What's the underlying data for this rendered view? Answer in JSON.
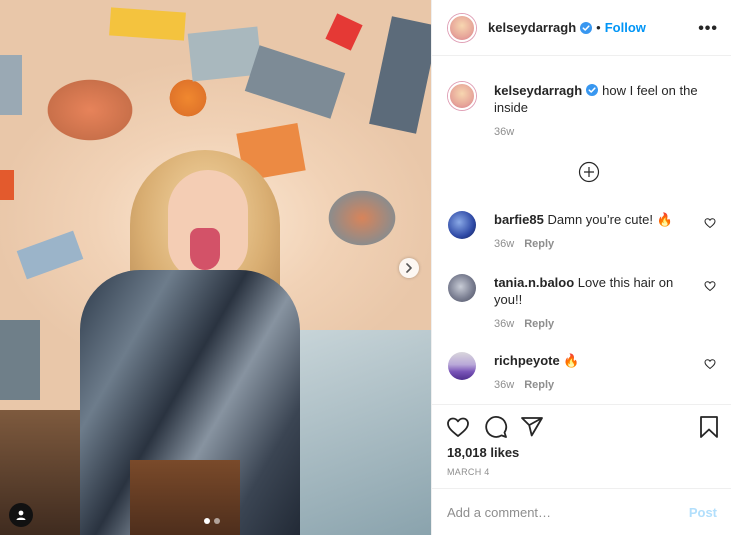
{
  "post": {
    "username": "kelseydarragh",
    "follow_label": "Follow",
    "more_label": "•••",
    "caption": "how I feel on the inside",
    "caption_time": "36w",
    "likes": "18,018 likes",
    "date": "MARCH 4",
    "add_comment_placeholder": "Add a comment…",
    "post_label": "Post",
    "carousel": {
      "slides": 2,
      "active": 0
    }
  },
  "comments": [
    {
      "user": "barfie85",
      "text": "Damn you’re cute! 🔥",
      "time": "36w",
      "reply": "Reply"
    },
    {
      "user": "tania.n.baloo",
      "text": "Love this hair on you!!",
      "time": "36w",
      "reply": "Reply"
    },
    {
      "user": "richpeyote",
      "text": "🔥",
      "time": "36w",
      "reply": "Reply"
    }
  ],
  "colors": {
    "follow": "#0095f6",
    "verified": "#3897f0",
    "post_disabled": "#b2dffc",
    "muted": "#8e8e8e"
  },
  "icons": [
    "chevron-right-icon",
    "user-tag-icon",
    "verified-badge-icon",
    "more-options-icon",
    "load-more-comments-icon",
    "heart-icon",
    "comment-icon",
    "share-icon",
    "bookmark-icon"
  ]
}
